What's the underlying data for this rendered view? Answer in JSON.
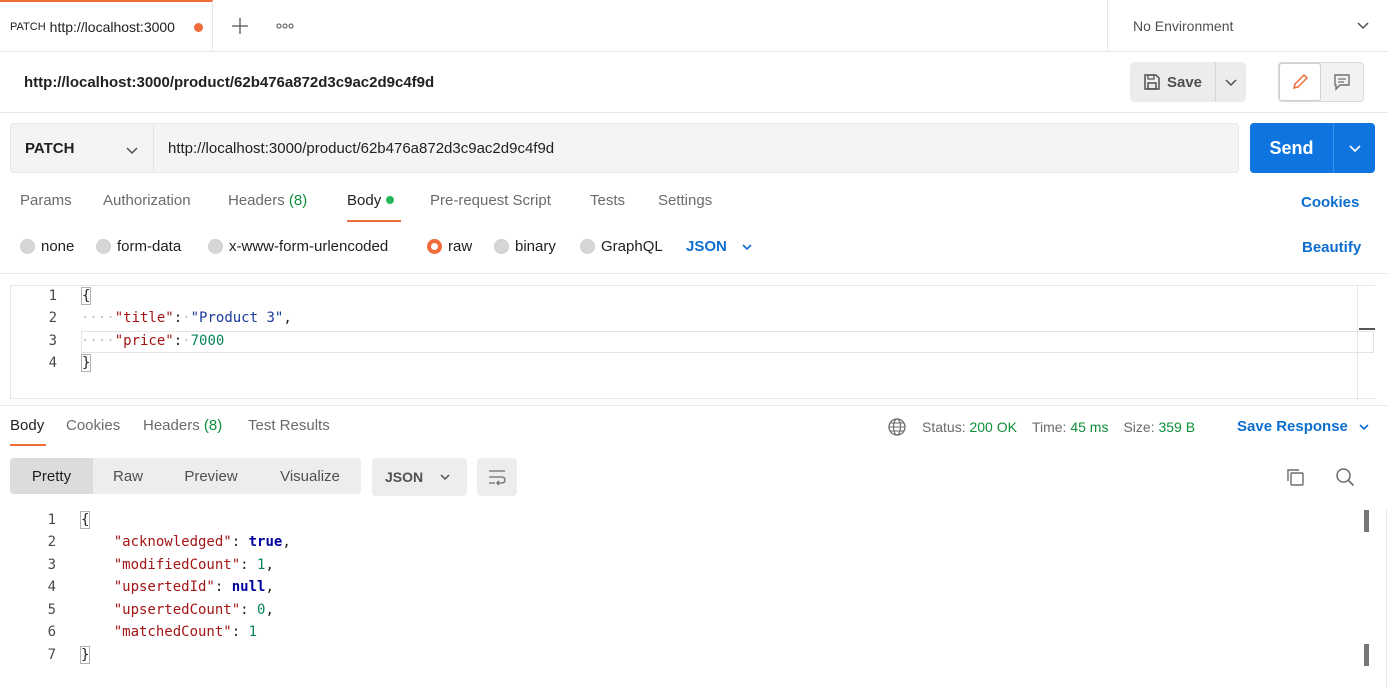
{
  "tab": {
    "method": "PATCH",
    "title": "http://localhost:3000"
  },
  "environment": {
    "label": "No Environment"
  },
  "request": {
    "title": "http://localhost:3000/product/62b476a872d3c9ac2d9c4f9d",
    "method": "PATCH",
    "url": "http://localhost:3000/product/62b476a872d3c9ac2d9c4f9d",
    "save_label": "Save",
    "send_label": "Send"
  },
  "request_tabs": {
    "params": "Params",
    "authorization": "Authorization",
    "headers": "Headers",
    "headers_count": "(8)",
    "body": "Body",
    "prerequest": "Pre-request Script",
    "tests": "Tests",
    "settings": "Settings",
    "cookies": "Cookies"
  },
  "body_types": {
    "none": "none",
    "form_data": "form-data",
    "urlencoded": "x-www-form-urlencoded",
    "raw": "raw",
    "binary": "binary",
    "graphql": "GraphQL",
    "format": "JSON",
    "beautify": "Beautify"
  },
  "request_body": {
    "lines": [
      "1",
      "2",
      "3",
      "4"
    ],
    "open": "{",
    "close": "}",
    "title_key": "\"title\"",
    "title_val": "\"Product 3\"",
    "price_key": "\"price\"",
    "price_val": "7000"
  },
  "response_tabs": {
    "body": "Body",
    "cookies": "Cookies",
    "headers": "Headers",
    "headers_count": "(8)",
    "test_results": "Test Results"
  },
  "response_meta": {
    "status_label": "Status:",
    "status": "200 OK",
    "time_label": "Time:",
    "time": "45 ms",
    "size_label": "Size:",
    "size": "359 B",
    "save_response": "Save Response"
  },
  "response_views": {
    "pretty": "Pretty",
    "raw": "Raw",
    "preview": "Preview",
    "visualize": "Visualize",
    "format": "JSON"
  },
  "response_body": {
    "lines": [
      "1",
      "2",
      "3",
      "4",
      "5",
      "6",
      "7"
    ],
    "open": "{",
    "close": "}",
    "k1": "\"acknowledged\"",
    "v1": "true",
    "k2": "\"modifiedCount\"",
    "v2": "1",
    "k3": "\"upsertedId\"",
    "v3": "null",
    "k4": "\"upsertedCount\"",
    "v4": "0",
    "k5": "\"matchedCount\"",
    "v5": "1"
  },
  "colors": {
    "accent": "#f26b3a",
    "send": "#0d74e0",
    "link": "#0d6ecf",
    "success": "#0f8f3a"
  }
}
